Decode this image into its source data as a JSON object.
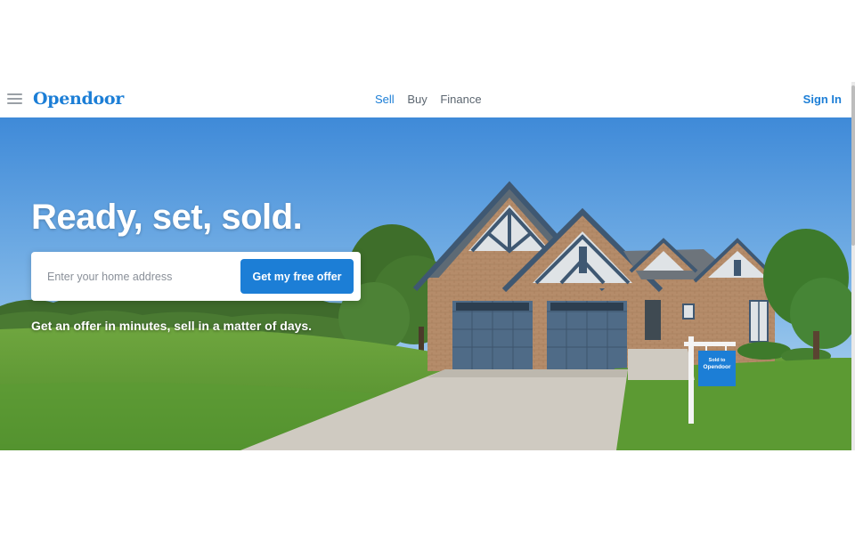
{
  "nav": {
    "logo": "Opendoor",
    "links": [
      "Sell",
      "Buy",
      "Finance"
    ],
    "active_link": "Sell",
    "sign_in": "Sign In",
    "menu_icon": "hamburger-menu-icon"
  },
  "hero": {
    "headline": "Ready, set, sold.",
    "address_placeholder": "Enter your home address",
    "address_value": "",
    "cta_label": "Get my free offer",
    "subheadline": "Get an offer in minutes, sell in a matter of days.",
    "yard_sign": {
      "line1": "Sold to",
      "line2": "Opendoor"
    }
  },
  "colors": {
    "brand": "#1c7ed6",
    "sky_top": "#3f8ad8",
    "grass": "#5e9c35",
    "brick": "#b58c6a",
    "trim": "#3f5872",
    "garage_door": "#4f6b87"
  }
}
